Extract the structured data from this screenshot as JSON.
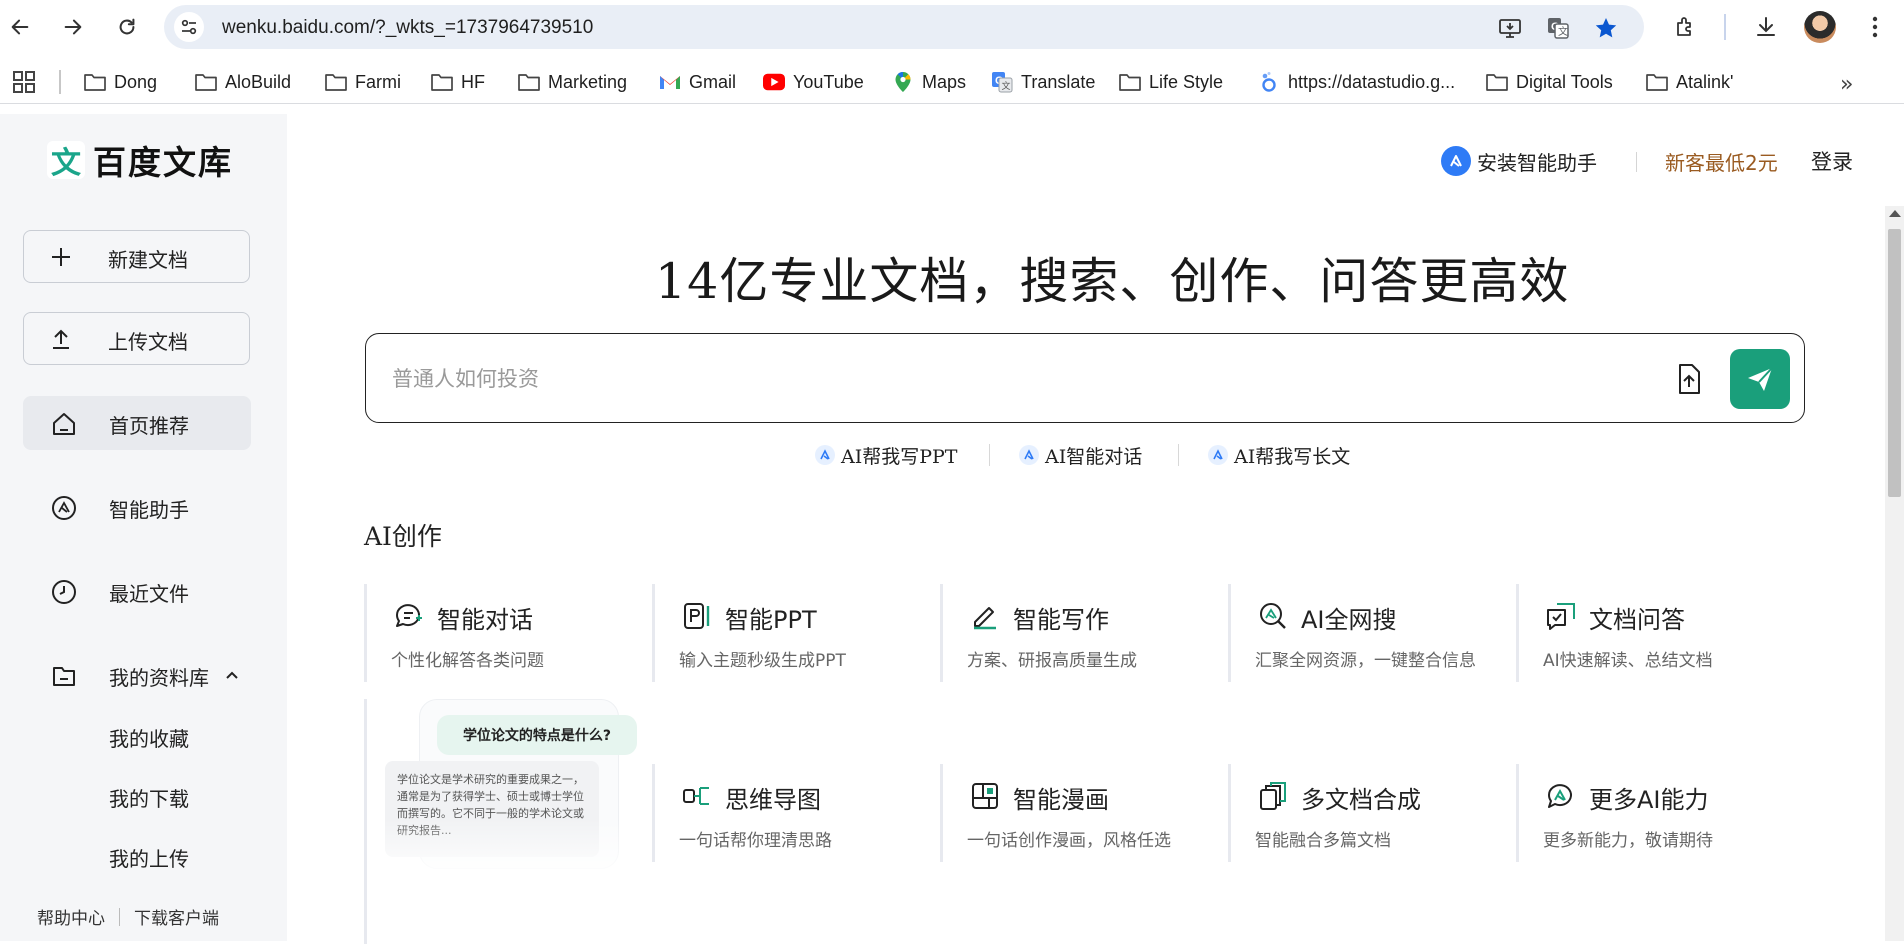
{
  "browser": {
    "url": "wenku.baidu.com/?_wkts_=1737964739510",
    "bookmarks": [
      {
        "label": "Dong",
        "icon": "folder-icon"
      },
      {
        "label": "AloBuild",
        "icon": "folder-icon"
      },
      {
        "label": "Farmi",
        "icon": "folder-icon"
      },
      {
        "label": "HF",
        "icon": "folder-icon"
      },
      {
        "label": "Marketing",
        "icon": "folder-icon"
      },
      {
        "label": "Gmail",
        "icon": "gmail-icon"
      },
      {
        "label": "YouTube",
        "icon": "youtube-icon"
      },
      {
        "label": "Maps",
        "icon": "maps-icon"
      },
      {
        "label": "Translate",
        "icon": "translate-icon"
      },
      {
        "label": "Life Style",
        "icon": "folder-icon"
      },
      {
        "label": "https://datastudio.g...",
        "icon": "datastudio-icon"
      },
      {
        "label": "Digital Tools",
        "icon": "folder-icon"
      },
      {
        "label": "Atalink'",
        "icon": "folder-icon"
      }
    ],
    "more_bookmarks": "»"
  },
  "brand": {
    "logo_mark": "文",
    "logo_text": "百度文库",
    "accent": "#1a9f7b",
    "promo_color": "#9a5b21"
  },
  "sidebar": {
    "new_doc": "新建文档",
    "upload_doc": "上传文档",
    "nav": [
      {
        "label": "首页推荐",
        "active": true
      },
      {
        "label": "智能助手",
        "active": false
      },
      {
        "label": "最近文件",
        "active": false
      },
      {
        "label": "我的资料库",
        "active": false
      }
    ],
    "library_sub": [
      "我的收藏",
      "我的下载",
      "我的上传"
    ],
    "footer": {
      "help": "帮助中心",
      "download_client": "下载客户端"
    }
  },
  "header": {
    "install_assistant": "安装智能助手",
    "promo": "新客最低2元",
    "login": "登录"
  },
  "hero": {
    "title": "14亿专业文档，搜索、创作、问答更高效"
  },
  "search": {
    "placeholder": "普通人如何投资"
  },
  "quick_actions": [
    "AI帮我写PPT",
    "AI智能对话",
    "AI帮我写长文"
  ],
  "ai_section": {
    "title": "AI创作",
    "cards": [
      {
        "title": "智能对话",
        "subtitle": "个性化解答各类问题",
        "icon": "chat-icon"
      },
      {
        "title": "智能PPT",
        "subtitle": "输入主题秒级生成PPT",
        "icon": "ppt-icon"
      },
      {
        "title": "智能写作",
        "subtitle": "方案、研报高质量生成",
        "icon": "pen-icon"
      },
      {
        "title": "AI全网搜",
        "subtitle": "汇聚全网资源，一键整合信息",
        "icon": "web-search-icon"
      },
      {
        "title": "文档问答",
        "subtitle": "AI快速解读、总结文档",
        "icon": "doc-qa-icon"
      },
      {
        "title": "思维导图",
        "subtitle": "一句话帮你理清思路",
        "icon": "mindmap-icon"
      },
      {
        "title": "智能漫画",
        "subtitle": "一句话创作漫画，风格任选",
        "icon": "comic-icon"
      },
      {
        "title": "多文档合成",
        "subtitle": "智能融合多篇文档",
        "icon": "multi-doc-icon"
      },
      {
        "title": "更多AI能力",
        "subtitle": "更多新能力，敬请期待",
        "icon": "more-ai-icon"
      }
    ],
    "preview": {
      "question": "学位论文的特点是什么?",
      "answer": "学位论文是学术研究的重要成果之一，通常是为了获得学士、硕士或博士学位而撰写的。它不同于一般的学术论文或研究报告..."
    }
  }
}
